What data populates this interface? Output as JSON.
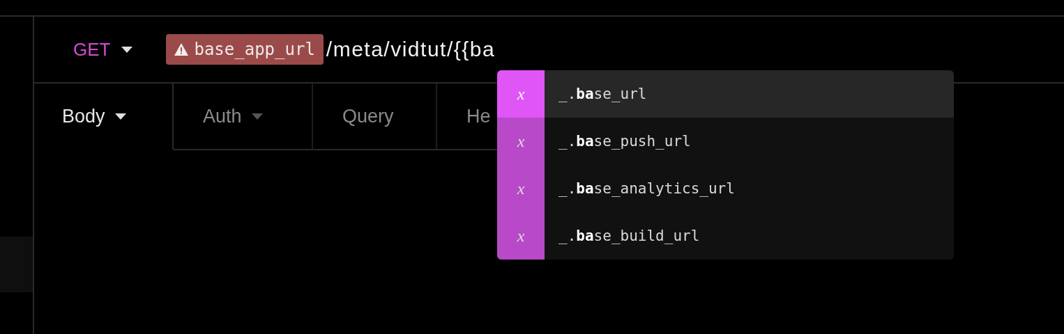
{
  "request": {
    "method": "GET",
    "variable_chip": {
      "label": "base_app_url",
      "warning": true
    },
    "url_text": "/meta/vidtut/{{ba"
  },
  "tabs": [
    {
      "label": "Body",
      "selected": true,
      "dropdown": true
    },
    {
      "label": "Auth",
      "selected": false,
      "dropdown": true
    },
    {
      "label": "Query",
      "selected": false,
      "dropdown": false
    },
    {
      "label": "He",
      "selected": false,
      "dropdown": false
    }
  ],
  "autocomplete": {
    "items": [
      {
        "type_glyph": "x",
        "label": "_.**ba**se_url",
        "selected": true
      },
      {
        "type_glyph": "x",
        "label": "_.**ba**se_push_url",
        "selected": false
      },
      {
        "type_glyph": "x",
        "label": "_.**ba**se_analytics_url",
        "selected": false
      },
      {
        "type_glyph": "x",
        "label": "_.**ba**se_build_url",
        "selected": false
      }
    ]
  }
}
